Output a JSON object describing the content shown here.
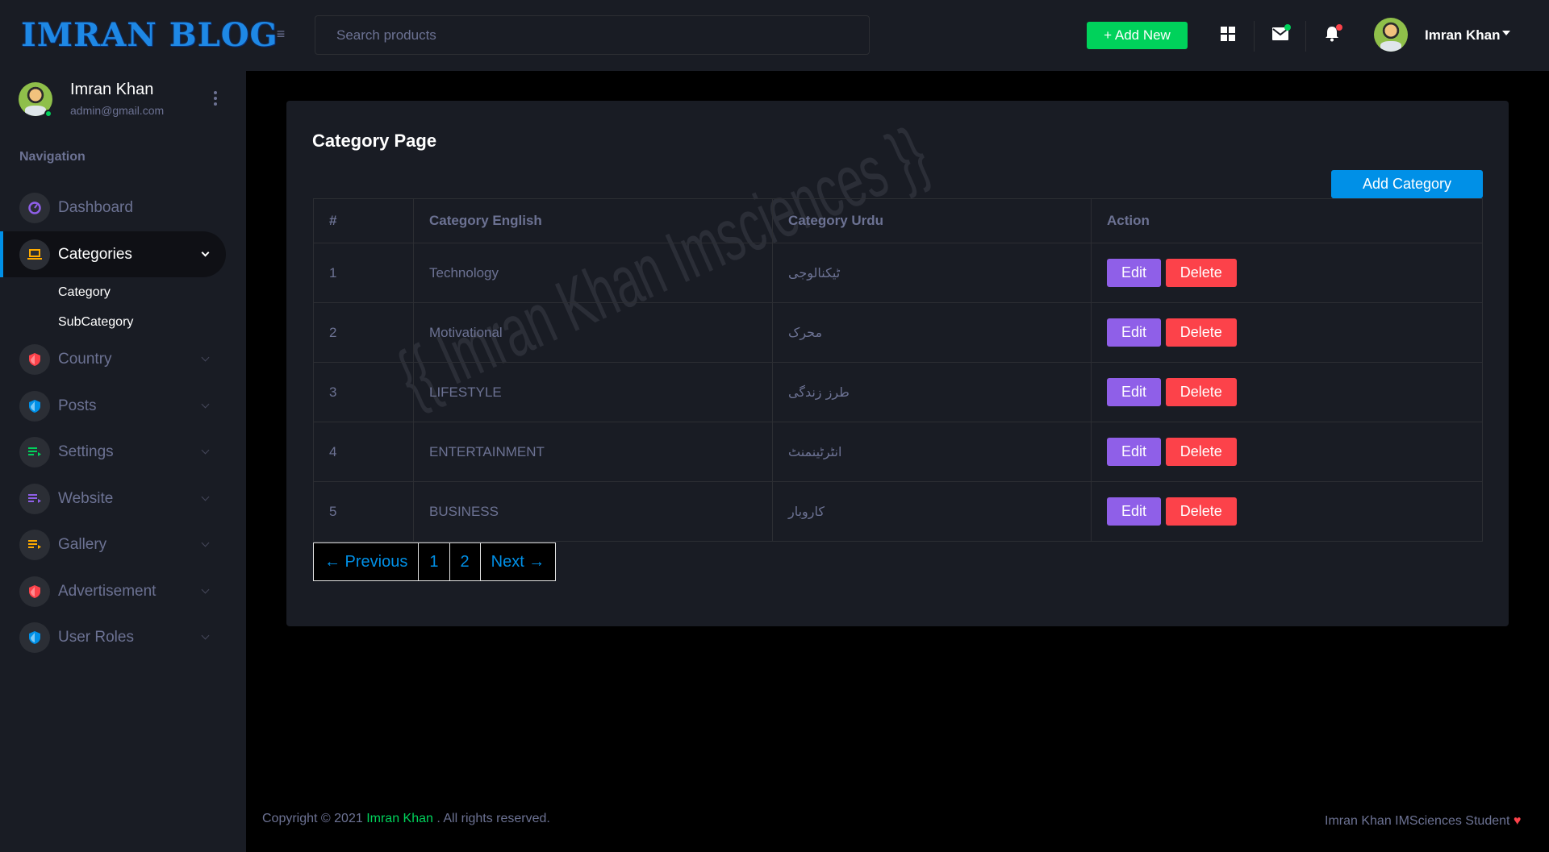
{
  "brand": {
    "title": "IMRAN BLOG"
  },
  "header": {
    "search_placeholder": "Search products",
    "add_new_label": "+ Add New",
    "user_name": "Imran Khan"
  },
  "sidebar": {
    "profile": {
      "name": "Imran Khan",
      "email": "admin@gmail.com"
    },
    "heading": "Navigation",
    "items": [
      {
        "label": "Dashboard",
        "icon": "speedometer-icon",
        "color": "#8f5fe8"
      },
      {
        "label": "Categories",
        "icon": "laptop-icon",
        "color": "#ffab00",
        "active": true
      },
      {
        "label": "Country",
        "icon": "security-icon",
        "color": "#fc424a"
      },
      {
        "label": "Posts",
        "icon": "security-icon",
        "color": "#0090e7"
      },
      {
        "label": "Settings",
        "icon": "playlist-play-icon",
        "color": "#00d25b"
      },
      {
        "label": "Website",
        "icon": "playlist-play-icon",
        "color": "#8f5fe8"
      },
      {
        "label": "Gallery",
        "icon": "playlist-play-icon",
        "color": "#ffab00"
      },
      {
        "label": "Advertisement",
        "icon": "security-icon",
        "color": "#fc424a"
      },
      {
        "label": "User Roles",
        "icon": "security-icon",
        "color": "#0090e7"
      }
    ],
    "sub_items": [
      "Category",
      "SubCategory"
    ]
  },
  "main": {
    "title": "Category Page",
    "add_button": "Add Category",
    "columns": [
      "#",
      "Category English",
      "Category Urdu",
      "Action"
    ],
    "rows": [
      {
        "id": "1",
        "english": "Technology",
        "urdu": "ٹیکنالوجی"
      },
      {
        "id": "2",
        "english": "Motivational",
        "urdu": "محرک"
      },
      {
        "id": "3",
        "english": "LIFESTYLE",
        "urdu": "طرز زندگی"
      },
      {
        "id": "4",
        "english": "ENTERTAINMENT",
        "urdu": "انٹرٹینمنٹ"
      },
      {
        "id": "5",
        "english": "BUSINESS",
        "urdu": "کاروبار"
      }
    ],
    "edit_label": "Edit",
    "delete_label": "Delete",
    "pagination": {
      "previous": "← Previous",
      "pages": [
        "1",
        "2"
      ],
      "next": "Next →"
    },
    "watermark": "{{ Imran Khan Imsciences }}"
  },
  "footer": {
    "copyright_prefix": "Copyright © 2021",
    "author": "Imran Khan",
    "rights": ". All rights reserved.",
    "right_text": "Imran Khan IMSciences Student"
  },
  "colors": {
    "accent": "#0090e7",
    "success": "#00d25b",
    "danger": "#fc424a",
    "primary": "#8f5fe8",
    "warning": "#ffab00"
  }
}
